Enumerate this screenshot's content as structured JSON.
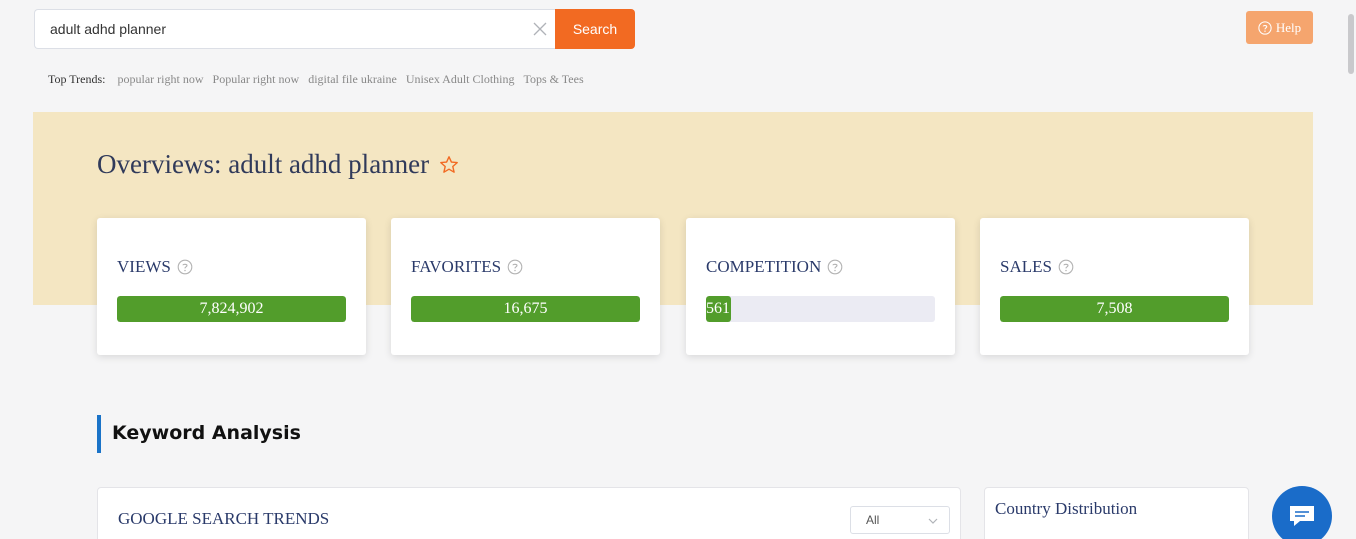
{
  "search": {
    "value": "adult adhd planner",
    "button_label": "Search"
  },
  "help": {
    "label": "Help"
  },
  "top_trends": {
    "label": "Top Trends:",
    "items": [
      "popular right now",
      "Popular right now",
      "digital file ukraine",
      "Unisex Adult Clothing",
      "Tops & Tees"
    ]
  },
  "overview": {
    "title": "Overviews: adult adhd planner",
    "cards": [
      {
        "label": "VIEWS",
        "value": "7,824,902",
        "fill_fraction": 1.0
      },
      {
        "label": "FAVORITES",
        "value": "16,675",
        "fill_fraction": 1.0
      },
      {
        "label": "COMPETITION",
        "value": "561",
        "fill_fraction": 0.11
      },
      {
        "label": "SALES",
        "value": "7,508",
        "fill_fraction": 1.0
      }
    ]
  },
  "keyword_analysis": {
    "title": "Keyword Analysis"
  },
  "google_search_trends": {
    "title": "GOOGLE SEARCH TRENDS",
    "select_value": "All"
  },
  "country_distribution": {
    "title": "Country Distribution"
  },
  "colors": {
    "accent": "#f26a22",
    "help": "#f5a56e",
    "band": "#f4e6c2",
    "bar_fill": "#529d2b",
    "bar_track": "#ebebf3",
    "section_marker": "#1a73c8",
    "chat": "#1a6cc9"
  },
  "icons": {
    "clear": "close-icon",
    "help": "question-circle-icon",
    "star": "star-outline-icon",
    "info": "question-circle-icon",
    "select": "chevron-down-icon",
    "chat": "chat-bubble-icon"
  }
}
